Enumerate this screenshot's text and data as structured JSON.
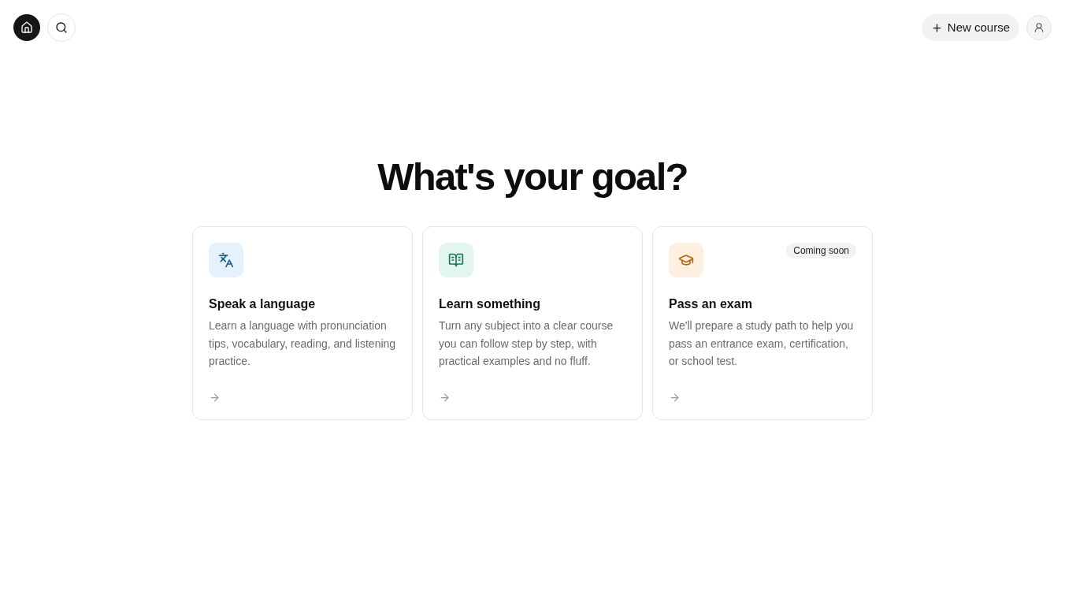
{
  "header": {
    "new_course_button": {
      "label": "New course"
    }
  },
  "heading": "What's your goal?",
  "goals": [
    {
      "kind": "language",
      "title": "Speak a language",
      "description": "Learn a language with pronunciation tips, vocabulary, reading, and listening practice."
    },
    {
      "kind": "learn",
      "title": "Learn something",
      "description": "Turn any subject into a clear course you can follow step by step, with practical examples and no fluff."
    },
    {
      "kind": "exam",
      "title": "Pass an exam",
      "description": "We'll prepare a study path to help you pass an entrance exam, certification, or school test.",
      "badge": "Coming soon"
    }
  ]
}
